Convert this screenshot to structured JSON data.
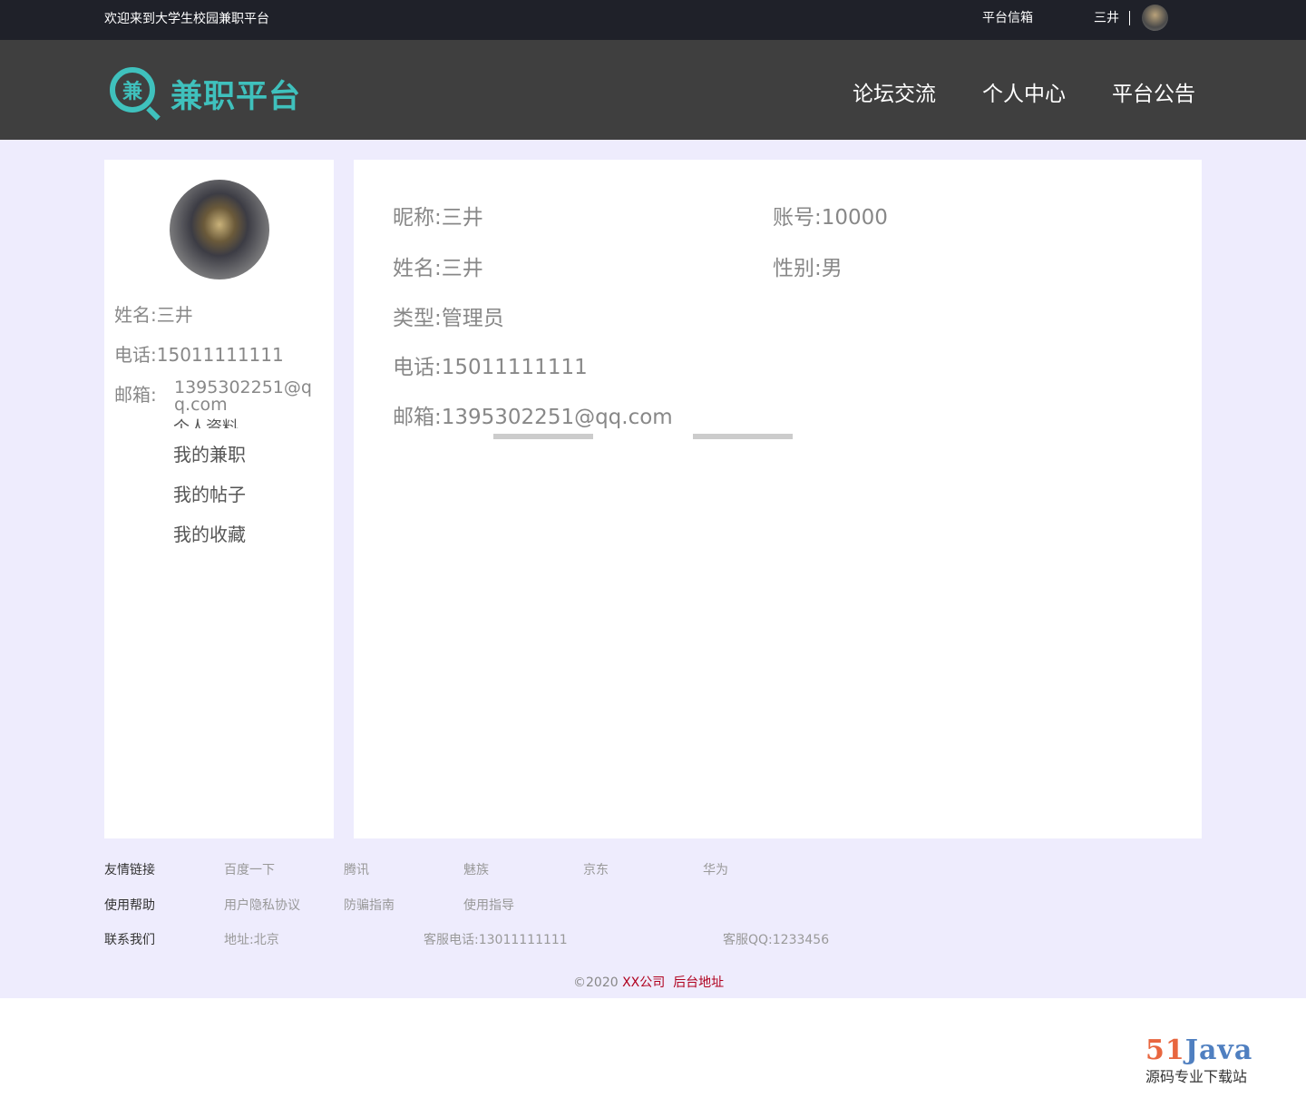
{
  "topbar": {
    "welcome": "欢迎来到大学生校园兼职平台",
    "mailbox": "平台信箱",
    "username": "三井"
  },
  "header": {
    "logo_char": "兼",
    "logo_text": "兼职平台",
    "nav": [
      "论坛交流",
      "个人中心",
      "平台公告"
    ]
  },
  "sidebar": {
    "name_label": "姓名:",
    "name": "三井",
    "phone_label": "电话:",
    "phone": "15011111111",
    "email_label": "邮箱:",
    "email": "1395302251@qq.com",
    "menu": [
      "个人资料",
      "我的兼职",
      "我的帖子",
      "我的收藏"
    ]
  },
  "profile": {
    "nickname": "昵称:三井",
    "account": "账号:10000",
    "name": "姓名:三井",
    "gender": "性别:男",
    "type": "类型:管理员",
    "phone": "电话:15011111111",
    "email": "邮箱:1395302251@qq.com"
  },
  "footer": {
    "links_label": "友情链接",
    "links": [
      "百度一下",
      "腾讯",
      "魅族",
      "京东",
      "华为"
    ],
    "help_label": "使用帮助",
    "help": [
      "用户隐私协议",
      "防骗指南",
      "使用指导"
    ],
    "contact_label": "联系我们",
    "contact": [
      "地址:北京",
      "客服电话:13011111111",
      "客服QQ:1233456"
    ],
    "copyright": "©2020",
    "company": "XX公司",
    "admin": "后台地址"
  },
  "watermark": {
    "num": "51",
    "brand": "Java",
    "slogan": "源码专业下载站"
  }
}
